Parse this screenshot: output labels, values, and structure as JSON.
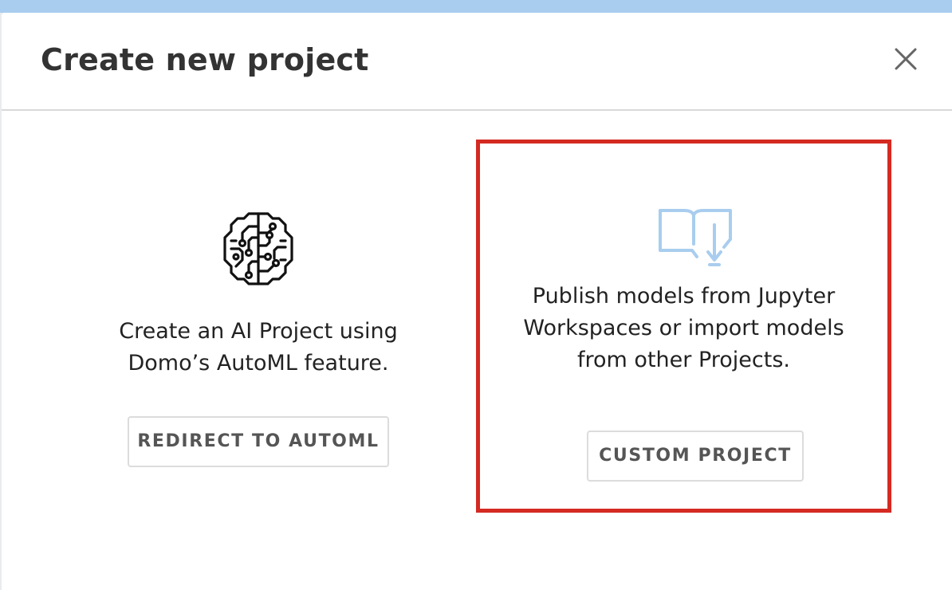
{
  "modal": {
    "title": "Create new project",
    "close_icon": "close-icon"
  },
  "options": {
    "automl": {
      "icon": "ai-brain-icon",
      "description": "Create an AI Project using Domo’s AutoML feature.",
      "button_label": "REDIRECT TO AUTOML"
    },
    "custom": {
      "icon": "import-book-icon",
      "description": "Publish models from Jupyter Workspaces or import models from other Projects.",
      "button_label": "CUSTOM PROJECT",
      "highlight_color": "#d42a22"
    }
  },
  "colors": {
    "top_strip": "#a9cdee",
    "icon_light_blue": "#a9cdee",
    "text_dark": "#333333"
  }
}
